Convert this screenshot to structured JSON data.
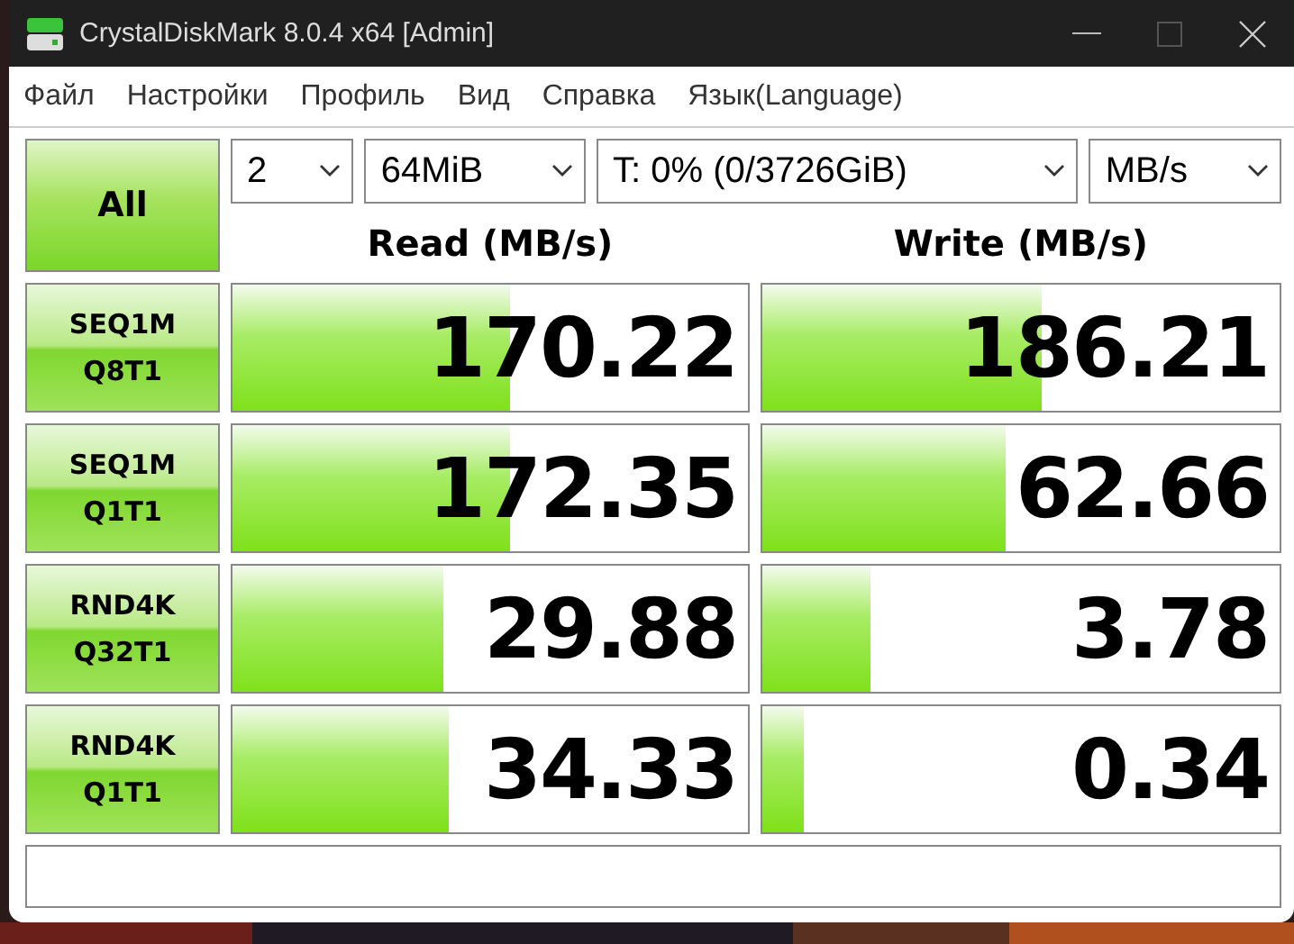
{
  "window": {
    "title": "CrystalDiskMark 8.0.4 x64 [Admin]"
  },
  "menu": [
    "Файл",
    "Настройки",
    "Профиль",
    "Вид",
    "Справка",
    "Язык(Language)"
  ],
  "all_button": "All",
  "selectors": [
    {
      "value": "2"
    },
    {
      "value": "64MiB"
    },
    {
      "value": "T: 0% (0/3726GiB)"
    },
    {
      "value": "MB/s"
    }
  ],
  "headers": [
    "Read (MB/s)",
    "Write (MB/s)"
  ],
  "tests": [
    {
      "label": [
        "SEQ1M",
        "Q8T1"
      ],
      "read": {
        "value": "170.22",
        "level": 0.54
      },
      "write": {
        "value": "186.21",
        "level": 0.54
      }
    },
    {
      "label": [
        "SEQ1M",
        "Q1T1"
      ],
      "read": {
        "value": "172.35",
        "level": 0.54
      },
      "write": {
        "value": "62.66",
        "level": 0.47
      }
    },
    {
      "label": [
        "RND4K",
        "Q32T1"
      ],
      "read": {
        "value": "29.88",
        "level": 0.41
      },
      "write": {
        "value": "3.78",
        "level": 0.21
      }
    },
    {
      "label": [
        "RND4K",
        "Q1T1"
      ],
      "read": {
        "value": "34.33",
        "level": 0.42
      },
      "write": {
        "value": "0.34",
        "level": 0.08
      }
    }
  ]
}
